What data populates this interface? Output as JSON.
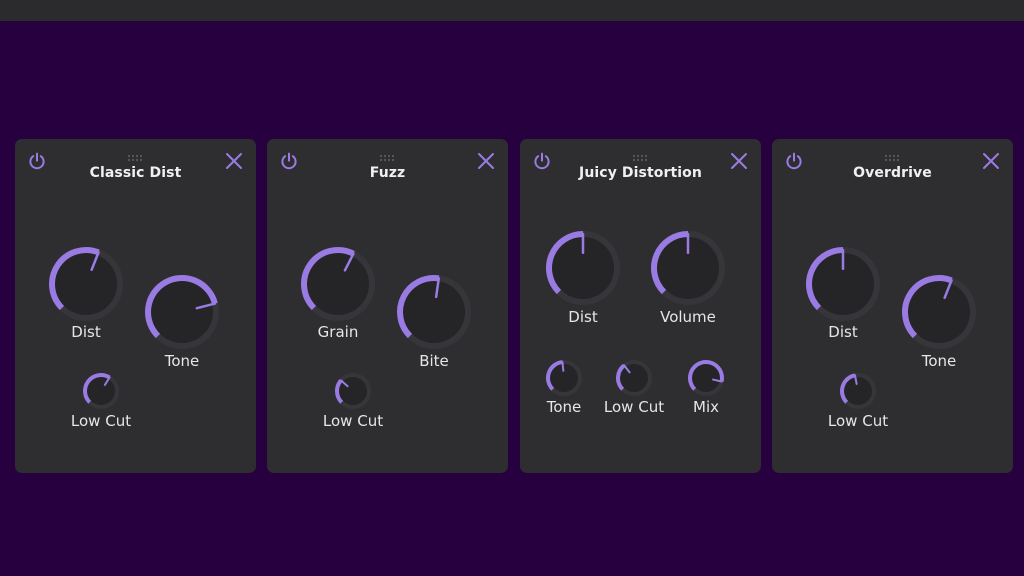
{
  "colors": {
    "background": "#27003f",
    "panel": "#2e2e31",
    "accent": "#9a7be4",
    "knob_face": "#252528",
    "knob_track": "#36363a",
    "text": "#e6e6e6"
  },
  "icons": {
    "power": "power-icon",
    "close": "close-icon",
    "grip": "drag-grip-icon"
  },
  "panels": [
    {
      "title": "Classic Dist",
      "knobs": [
        {
          "label": "Dist",
          "value": 0.58
        },
        {
          "label": "Tone",
          "value": 0.78
        },
        {
          "label": "Low Cut",
          "value": 0.62
        }
      ]
    },
    {
      "title": "Fuzz",
      "knobs": [
        {
          "label": "Grain",
          "value": 0.6
        },
        {
          "label": "Bite",
          "value": 0.53
        },
        {
          "label": "Low Cut",
          "value": 0.32
        }
      ]
    },
    {
      "title": "Juicy Distortion",
      "knobs": [
        {
          "label": "Dist",
          "value": 0.5
        },
        {
          "label": "Volume",
          "value": 0.5
        },
        {
          "label": "Tone",
          "value": 0.48
        },
        {
          "label": "Low Cut",
          "value": 0.36
        },
        {
          "label": "Mix",
          "value": 0.88
        }
      ]
    },
    {
      "title": "Overdrive",
      "knobs": [
        {
          "label": "Dist",
          "value": 0.5
        },
        {
          "label": "Tone",
          "value": 0.58
        },
        {
          "label": "Low Cut",
          "value": 0.46
        }
      ]
    }
  ]
}
